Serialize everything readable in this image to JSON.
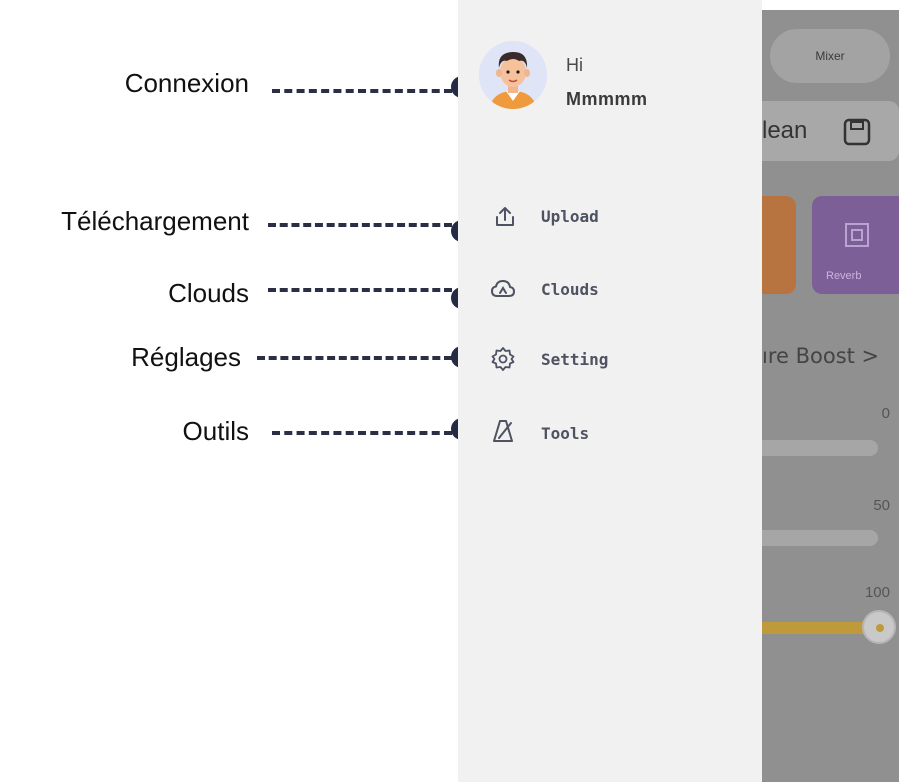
{
  "annotations": [
    {
      "key": "login",
      "label": "Connexion"
    },
    {
      "key": "upload",
      "label": "Téléchargement"
    },
    {
      "key": "clouds",
      "label": "Clouds"
    },
    {
      "key": "settings",
      "label": "Réglages"
    },
    {
      "key": "tools",
      "label": "Outils"
    }
  ],
  "drawer": {
    "greeting": "Hi",
    "username": "Mmmmm",
    "menu": [
      {
        "label": "Upload",
        "icon": "upload-icon"
      },
      {
        "label": "Clouds",
        "icon": "cloud-icon"
      },
      {
        "label": "Setting",
        "icon": "gear-icon"
      },
      {
        "label": "Tools",
        "icon": "metronome-icon"
      }
    ]
  },
  "background_app": {
    "mixer_label": "Mixer",
    "preset_name": "lean",
    "reverb_label": "Reverb",
    "boost_label": "ıre Boost >",
    "slider_values": [
      "0",
      "50",
      "100"
    ],
    "slider_level_fraction": 1.0
  },
  "colors": {
    "drawer_bg": "#f1f1f1",
    "dot": "#262b44",
    "slider_fill": "#bf9a3a"
  }
}
